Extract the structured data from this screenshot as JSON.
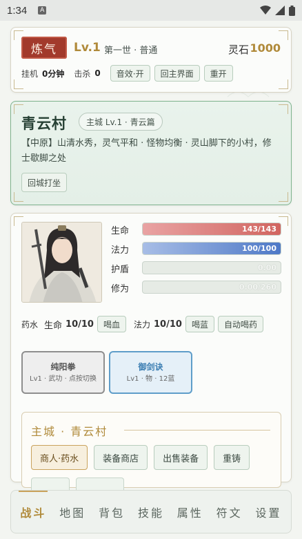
{
  "status_bar": {
    "time": "1:34",
    "app_icon": "A"
  },
  "header": {
    "realm": "炼气",
    "level": "Lv.1",
    "life": "第一世 · 普通",
    "stone_label": "灵石",
    "stone_value": "1000",
    "afk_label": "挂机",
    "afk_value": "0分钟",
    "kill_label": "击杀",
    "kill_value": "0",
    "sound_btn": "音效·开",
    "home_btn": "回主界面",
    "restart_btn": "重开"
  },
  "location": {
    "name": "青云村",
    "tag": "主城 Lv.1 · 青云篇",
    "description": "【中原】山清水秀，灵气平和 · 怪物均衡 · 灵山脚下的小村，修士歇脚之处",
    "meditate_btn": "回城打坐"
  },
  "character": {
    "stats": [
      {
        "label": "生命",
        "text": "143/143",
        "fraction": 1.0
      },
      {
        "label": "法力",
        "text": "100/100",
        "fraction": 1.0
      },
      {
        "label": "护盾",
        "text": "0.00",
        "fraction": 0.0
      },
      {
        "label": "修为",
        "text": "0.00/260",
        "fraction": 0.0
      }
    ],
    "potions": {
      "label": "药水",
      "hp_label": "生命",
      "hp_value": "10/10",
      "hp_btn": "喝血",
      "mp_label": "法力",
      "mp_value": "10/10",
      "mp_btn": "喝蓝",
      "auto_btn": "自动喝药"
    },
    "skills": [
      {
        "name": "纯阳拳",
        "desc": "Lv1 · 武功 · 点按切换"
      },
      {
        "name": "御剑诀",
        "desc": "Lv1 · 物 · 12蓝"
      }
    ]
  },
  "city": {
    "title": "主城 · 青云村",
    "buttons": [
      "商人·药水",
      "装备商店",
      "出售装备",
      "重铸"
    ]
  },
  "nav": {
    "items": [
      "战斗",
      "地图",
      "背包",
      "技能",
      "属性",
      "符文",
      "设置"
    ],
    "active_index": 0
  },
  "colors": {
    "accent_gold": "#b08a3a",
    "realm_red": "#a23a2c",
    "hp": "#d16560",
    "mp": "#4e79c7",
    "location_border": "#7fb38d"
  }
}
